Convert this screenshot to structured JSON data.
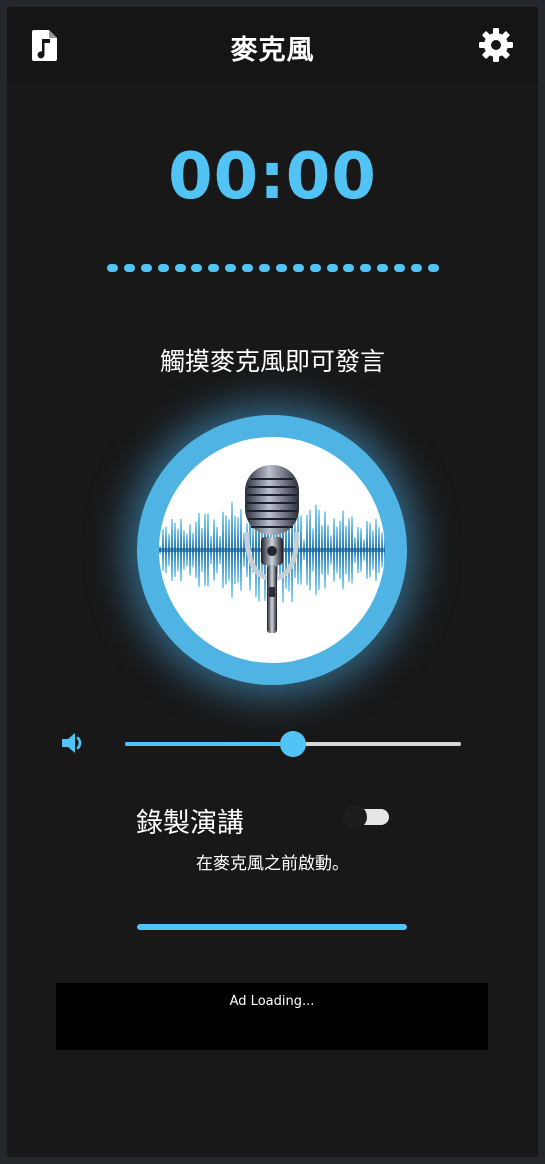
{
  "app_bar": {
    "title": "麥克風",
    "left_icon": "music-file-icon",
    "right_icon": "gear-icon"
  },
  "timer": "00:00",
  "level_dots_count": 20,
  "prompt": "觸摸麥克風即可發言",
  "mic_button": {
    "icon": "microphone-icon"
  },
  "volume": {
    "icon": "speaker-icon",
    "value_fraction": 0.5
  },
  "record": {
    "label": "錄製演講",
    "enabled": false,
    "subtitle": "在麥克風之前啟動。"
  },
  "ad": {
    "text": "Ad Loading..."
  },
  "colors": {
    "accent": "#52c3f5",
    "background": "#181818",
    "app_bar": "#151515",
    "text": "#ffffff"
  }
}
